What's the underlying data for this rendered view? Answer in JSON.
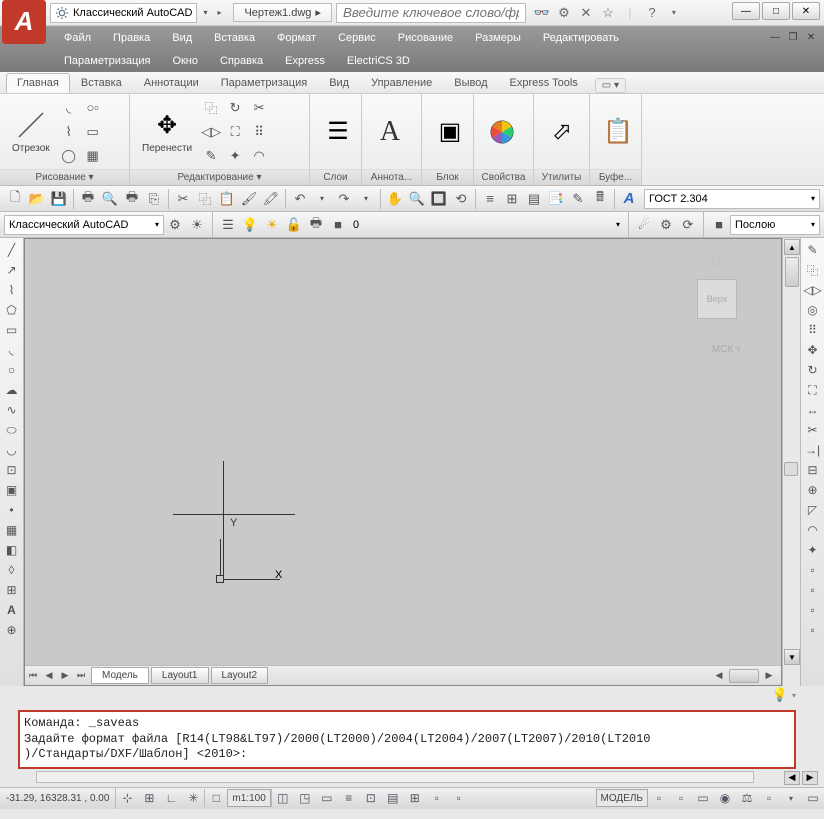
{
  "titlebar": {
    "workspace": "Классический AutoCAD",
    "filename": "Чертеж1.dwg",
    "search_placeholder": "Введите ключевое слово/фразу"
  },
  "menu": {
    "row1": [
      "Файл",
      "Правка",
      "Вид",
      "Вставка",
      "Формат",
      "Сервис",
      "Рисование",
      "Размеры",
      "Редактировать"
    ],
    "row2": [
      "Параметризация",
      "Окно",
      "Справка",
      "Express",
      "ElectriCS 3D"
    ]
  },
  "ribbon_tabs": [
    "Главная",
    "Вставка",
    "Аннотации",
    "Параметризация",
    "Вид",
    "Управление",
    "Вывод",
    "Express Tools"
  ],
  "panels": {
    "line": "Отрезок",
    "move": "Перенести",
    "draw": "Рисование ▾",
    "edit": "Редактирование ▾",
    "layers": "Слои",
    "annot": "Аннота...",
    "block": "Блок",
    "props": "Свойства",
    "utils": "Утилиты",
    "clip": "Буфе..."
  },
  "std_font": "ГОСТ 2.304",
  "ws_combo": "Классический AutoCAD",
  "layer_combo": "0",
  "bylayer": "Послою",
  "viewcube": {
    "top": "Верх",
    "wcs": "МСК"
  },
  "model_tabs": {
    "model": "Модель",
    "l1": "Layout1",
    "l2": "Layout2"
  },
  "command": {
    "line1": "Команда: _saveas",
    "line2": "Задайте формат файла [R14(LT98&LT97)/2000(LT2000)/2004(LT2004)/2007(LT2007)/2010(LT2010",
    "line3": ")/Стандарты/DXF/Шаблон] <2010>:"
  },
  "status": {
    "coords": "-31.29,  16328.31 , 0.00",
    "scale": "m1:100",
    "model": "МОДЕЛЬ"
  },
  "ucs": {
    "x": "X",
    "y": "Y"
  }
}
